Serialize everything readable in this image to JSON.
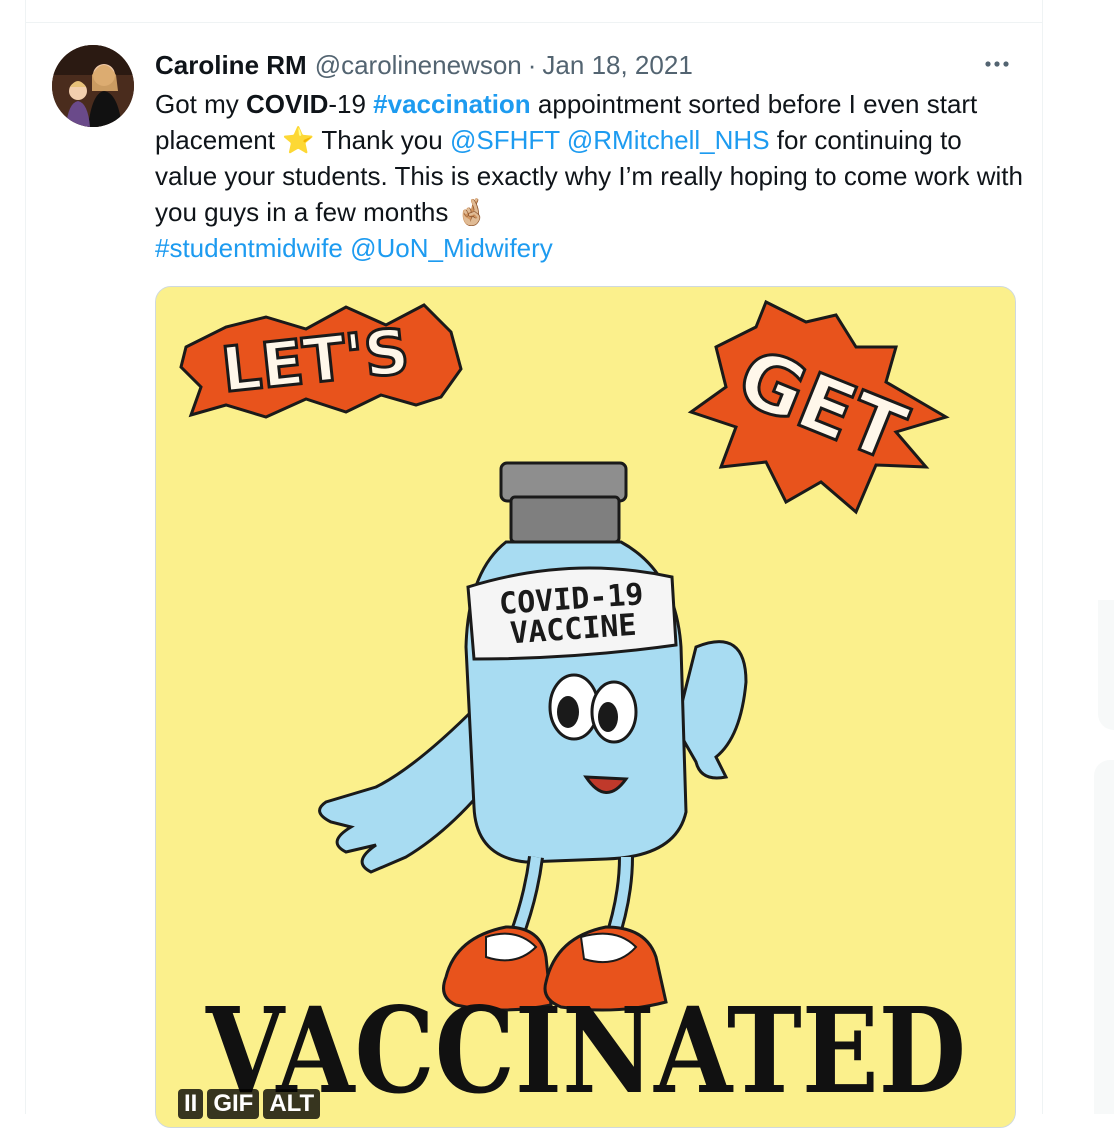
{
  "tweet": {
    "author_name": "Caroline RM",
    "author_handle": "@carolinenewson",
    "separator": "·",
    "date": "Jan 18, 2021",
    "more_glyph": "•••",
    "text": {
      "t1": "Got my ",
      "t2": "COVID",
      "t3": "-19 ",
      "tag1": "#vaccination",
      "t4": " appointment sorted before I even start placement ",
      "star": "⭐",
      "t5": " Thank you ",
      "mention1": "@SFHFT",
      "t6": " ",
      "mention2": "@RMitchell_NHS",
      "t7": " for continuing to value your students. This is exactly why I’m really hoping to come work with you guys in a few months ",
      "fingers": "🤞🏼",
      "tag2": "#studentmidwife",
      "t8": " ",
      "mention3": "@UoN_Midwifery"
    }
  },
  "media": {
    "gif_text": {
      "lets": "LET'S",
      "get": "GET",
      "label_line1": "COVID-19",
      "label_line2": "VACCINE",
      "vaccinated": "VACCINATED"
    },
    "badges": {
      "pause": "II",
      "gif": "GIF",
      "alt": "ALT"
    }
  },
  "colors": {
    "link": "#1d9bf0",
    "gif_background": "#fbf08c",
    "burst_orange": "#e8531c",
    "vial_blue": "#a8dcf2"
  },
  "icons": [
    "more-options-icon",
    "pause-icon",
    "star-emoji",
    "crossed-fingers-emoji"
  ]
}
